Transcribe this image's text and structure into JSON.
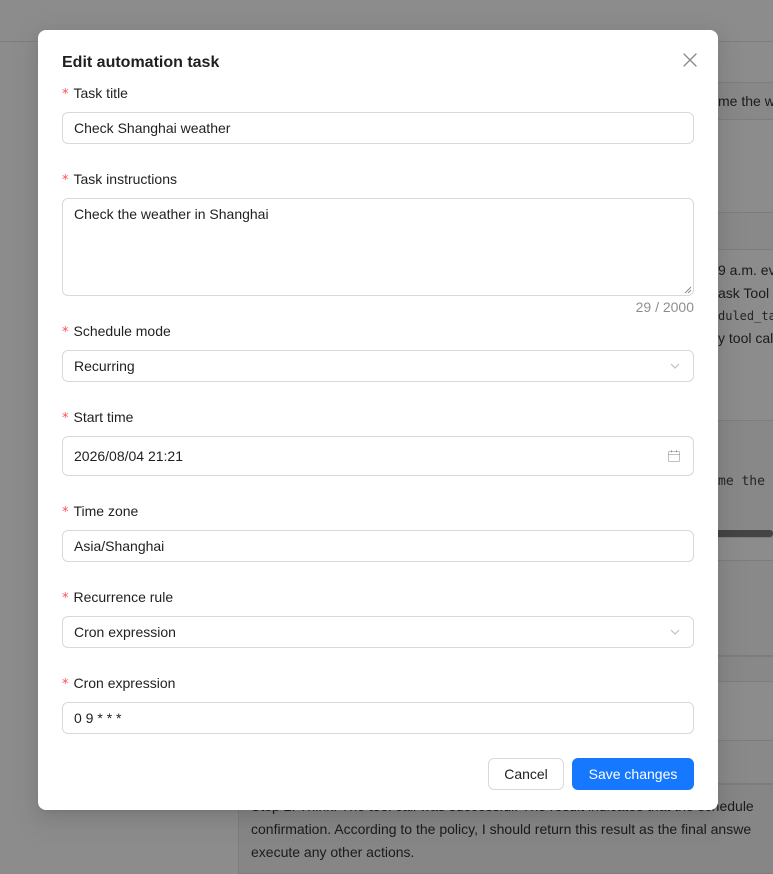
{
  "background": {
    "snippets": [
      "me the w",
      "9 a.m. ev",
      "ask Tool",
      "duled_ta",
      "y tool cal",
      "me the",
      "Step 2: Think: The tool call was successful. The result indicates that the schedule",
      "confirmation. According to the policy, I should return this result as the final answe",
      "execute any other actions."
    ]
  },
  "modal": {
    "title": "Edit automation task",
    "fields": {
      "task_title": {
        "label": "Task title",
        "value": "Check Shanghai weather"
      },
      "task_instructions": {
        "label": "Task instructions",
        "value": "Check the weather in Shanghai",
        "counter": "29 / 2000"
      },
      "schedule_mode": {
        "label": "Schedule mode",
        "value": "Recurring"
      },
      "start_time": {
        "label": "Start time",
        "value": "2026/08/04 21:21"
      },
      "time_zone": {
        "label": "Time zone",
        "value": "Asia/Shanghai"
      },
      "recurrence_rule": {
        "label": "Recurrence rule",
        "value": "Cron expression"
      },
      "cron_expression": {
        "label": "Cron expression",
        "value": "0 9 * * *"
      }
    },
    "required_mark": "*",
    "buttons": {
      "cancel": "Cancel",
      "save": "Save changes"
    }
  },
  "colors": {
    "primary": "#1677ff",
    "required": "#ff4d4f",
    "border": "#d9d9d9"
  }
}
